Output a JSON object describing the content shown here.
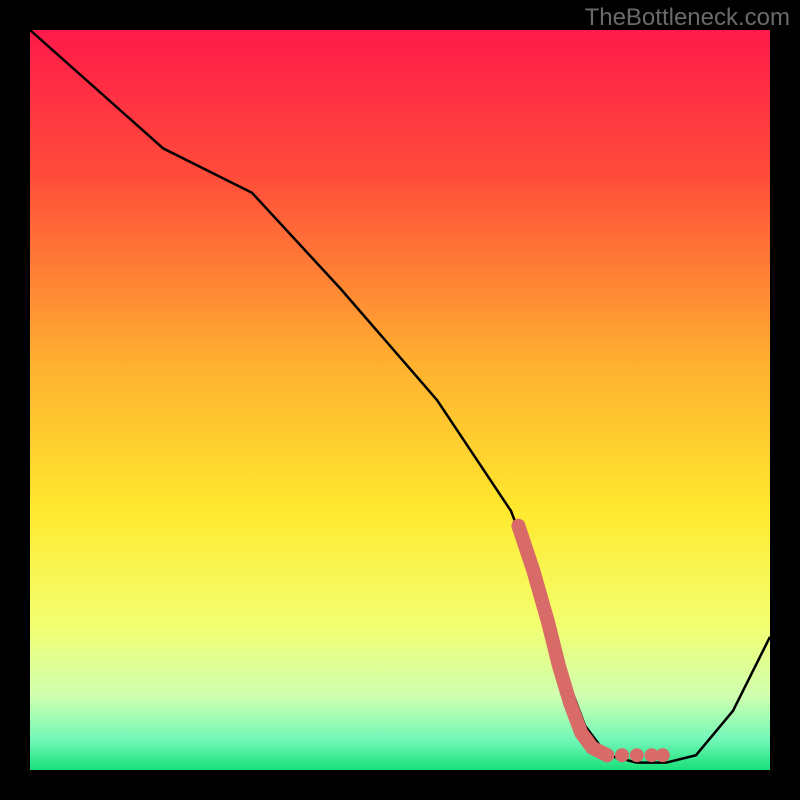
{
  "watermark": "TheBottleneck.com",
  "chart_data": {
    "type": "line",
    "title": "",
    "xlabel": "",
    "ylabel": "",
    "xlim": [
      0,
      100
    ],
    "ylim": [
      0,
      100
    ],
    "gradient_stops": [
      {
        "offset": 0,
        "color": "#ff1a4a"
      },
      {
        "offset": 20,
        "color": "#ff4d3a"
      },
      {
        "offset": 45,
        "color": "#ffb030"
      },
      {
        "offset": 65,
        "color": "#ffe92e"
      },
      {
        "offset": 80,
        "color": "#f4ff6e"
      },
      {
        "offset": 90,
        "color": "#d0ffb0"
      },
      {
        "offset": 96,
        "color": "#70f7b8"
      },
      {
        "offset": 100,
        "color": "#18e07a"
      }
    ],
    "series": [
      {
        "name": "curve",
        "x": [
          0,
          18,
          30,
          42,
          55,
          65,
          70,
          72,
          75,
          78,
          82,
          86,
          90,
          95,
          100
        ],
        "y": [
          100,
          84,
          78,
          65,
          50,
          35,
          22,
          14,
          6,
          2,
          1,
          1,
          2,
          8,
          18
        ]
      }
    ],
    "highlight_segment": {
      "name": "overlay-dots",
      "color": "#d86a67",
      "points": [
        {
          "x": 66,
          "y": 33
        },
        {
          "x": 68,
          "y": 27
        },
        {
          "x": 70,
          "y": 20
        },
        {
          "x": 71.5,
          "y": 14
        },
        {
          "x": 73,
          "y": 9
        },
        {
          "x": 74.5,
          "y": 5
        },
        {
          "x": 76,
          "y": 3
        },
        {
          "x": 78,
          "y": 2
        },
        {
          "x": 80,
          "y": 2
        },
        {
          "x": 82,
          "y": 2
        },
        {
          "x": 84,
          "y": 2
        },
        {
          "x": 85.5,
          "y": 2
        }
      ]
    }
  }
}
